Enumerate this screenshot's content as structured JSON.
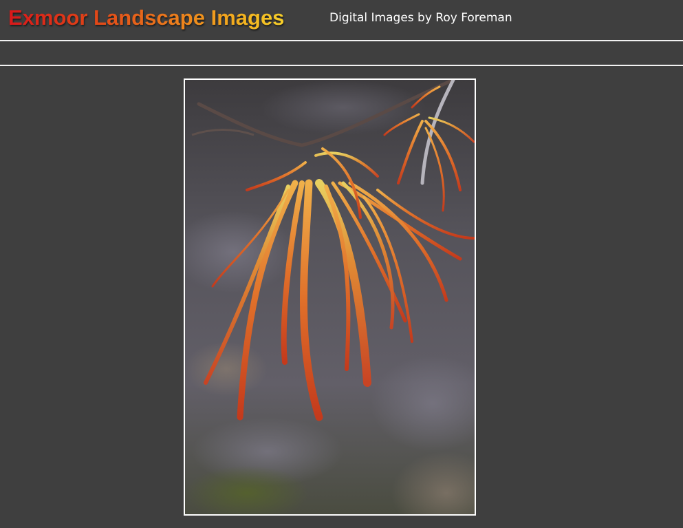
{
  "header": {
    "site_title": "Exmoor Landscape Images",
    "tagline": "Digital Images by Roy Foreman"
  },
  "photo": {
    "subject": "autumn-leaves-photo"
  },
  "colors": {
    "background": "#3f3f3f",
    "rule": "#f2f2f2",
    "title_gradient_start": "#d8181a",
    "title_gradient_end": "#f6cf2a"
  }
}
